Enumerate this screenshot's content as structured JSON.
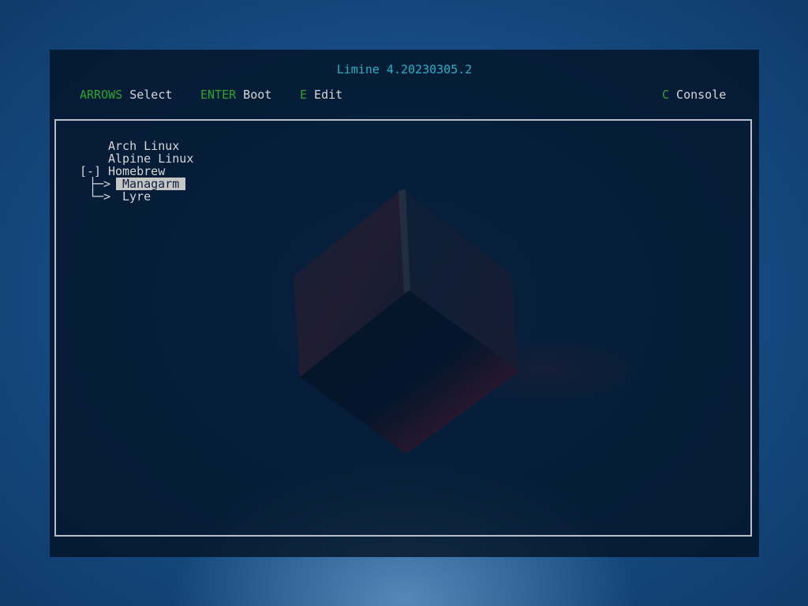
{
  "header": {
    "title": "Limine 4.20230305.2"
  },
  "hints": [
    {
      "key": "ARROWS",
      "label": " Select"
    },
    {
      "key": "ENTER",
      "label": " Boot"
    },
    {
      "key": "E",
      "label": " Edit"
    },
    {
      "key": "C",
      "label": " Console"
    }
  ],
  "menu": {
    "entries": [
      {
        "label": "Arch Linux"
      },
      {
        "label": "Alpine Linux"
      },
      {
        "toggle": "[-]",
        "label": "Homebrew"
      }
    ],
    "children": [
      {
        "connector": "├─>",
        "label": "Managarm",
        "selected": true
      },
      {
        "connector": "└─>",
        "label": "Lyre",
        "selected": false
      }
    ]
  },
  "colors": {
    "title": "#2ab1c6",
    "key": "#2fa52f",
    "text": "#d7d7d7",
    "selection_bg": "#c6c6c6",
    "border": "#b9bfc6"
  }
}
